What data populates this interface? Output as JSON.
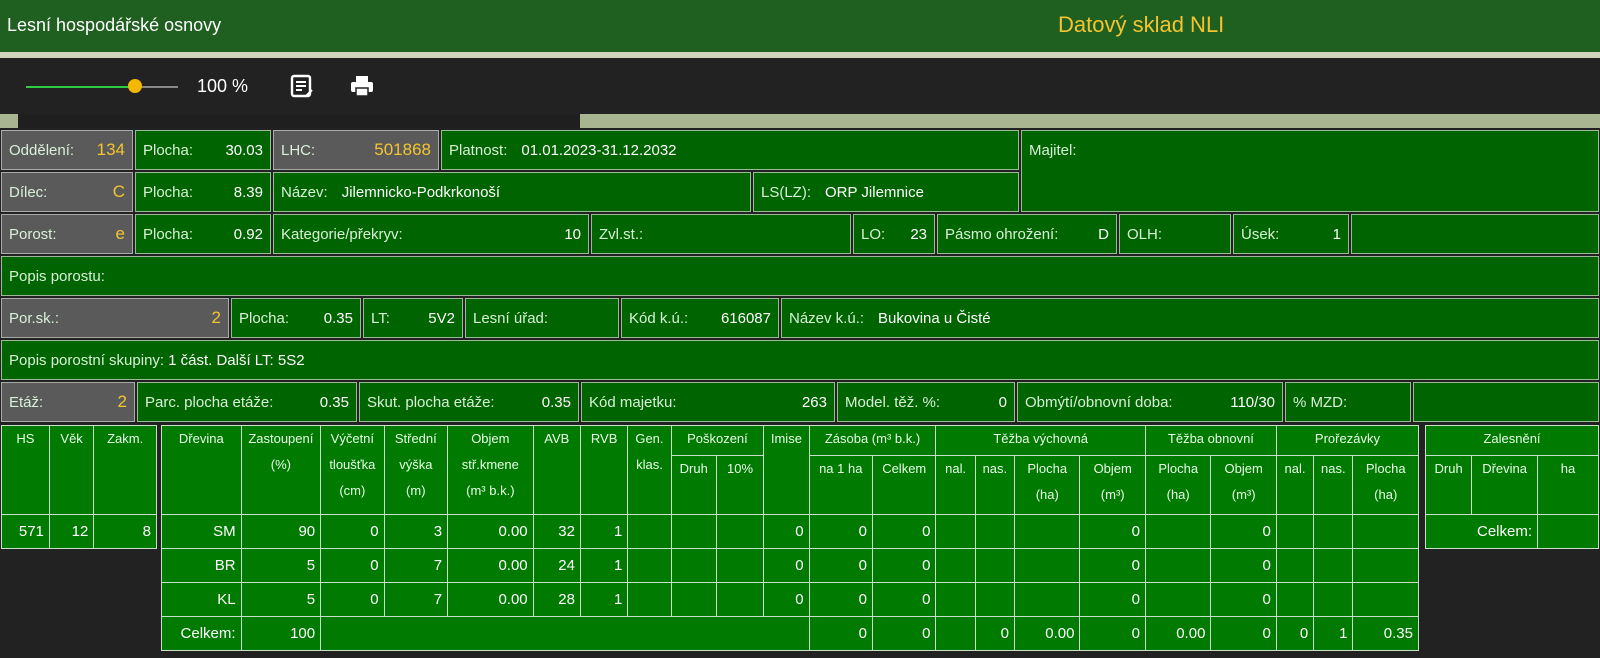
{
  "header": {
    "title": "Lesní hospodářské osnovy",
    "brand": "Datový sklad NLI"
  },
  "toolbar": {
    "zoom_label": "100 %",
    "zoom_value": 0.72,
    "colors": {
      "accent": "#f5b800",
      "header": "#1f5f1f",
      "cell": "#006400"
    }
  },
  "row1": {
    "oddeleni_label": "Oddělení:",
    "oddeleni_value": "134",
    "plocha_label": "Plocha:",
    "plocha_value": "30.03",
    "lhc_label": "LHC:",
    "lhc_value": "501868",
    "platnost_label": "Platnost:",
    "platnost_value": "01.01.2023-31.12.2032",
    "majitel_label": "Majitel:"
  },
  "row2": {
    "dilec_label": "Dílec:",
    "dilec_value": "C",
    "plocha_label": "Plocha:",
    "plocha_value": "8.39",
    "nazev_label": "Název:",
    "nazev_value": "Jilemnicko-Podkrkonoší",
    "ls_label": "LS(LZ):",
    "ls_value": "ORP Jilemnice"
  },
  "row3": {
    "porost_label": "Porost:",
    "porost_value": "e",
    "plocha_label": "Plocha:",
    "plocha_value": "0.92",
    "kategorie_label": "Kategorie/překryv:",
    "kategorie_value": "10",
    "zvl_label": "Zvl.st.:",
    "lo_label": "LO:",
    "lo_value": "23",
    "pasmo_label": "Pásmo ohrožení:",
    "pasmo_value": "D",
    "olh_label": "OLH:",
    "usek_label": "Úsek:",
    "usek_value": "1"
  },
  "row4": {
    "popis_porostu_label": "Popis porostu:"
  },
  "row5": {
    "porsk_label": "Por.sk.:",
    "porsk_value": "2",
    "plocha_label": "Plocha:",
    "plocha_value": "0.35",
    "lt_label": "LT:",
    "lt_value": "5V2",
    "lesni_urad_label": "Lesní úřad:",
    "kod_ku_label": "Kód k.ú.:",
    "kod_ku_value": "616087",
    "nazev_ku_label": "Název k.ú.:",
    "nazev_ku_value": "Bukovina u Čisté"
  },
  "row6": {
    "popis_skupiny_label": "Popis porostní skupiny:",
    "popis_skupiny_value": "1 část. Další LT: 5S2"
  },
  "row7": {
    "etaz_label": "Etáž:",
    "etaz_value": "2",
    "parc_label": "Parc. plocha etáže:",
    "parc_value": "0.35",
    "skut_label": "Skut. plocha etáže:",
    "skut_value": "0.35",
    "kod_majetku_label": "Kód majetku:",
    "kod_majetku_value": "263",
    "model_label": "Model. těž. %:",
    "model_value": "0",
    "obmyti_label": "Obmýtí/obnovní doba:",
    "obmyti_value": "110/30",
    "mzd_label": "% MZD:"
  },
  "hs_table": {
    "headers": [
      "HS",
      "Věk",
      "Zakm."
    ],
    "values": [
      "571",
      "12",
      "8"
    ]
  },
  "main_table": {
    "h_drevina": "Dřevina",
    "h_zastoupeni": [
      "Zastoupení",
      "(%)"
    ],
    "h_vycetni": [
      "Výčetní",
      "tloušťka",
      "(cm)"
    ],
    "h_stredni": [
      "Střední",
      "výška",
      "(m)"
    ],
    "h_objem": [
      "Objem",
      "stř.kmene",
      "(m³ b.k.)"
    ],
    "h_avb": "AVB",
    "h_rvb": "RVB",
    "h_gen": [
      "Gen.",
      "klas."
    ],
    "h_poskozeni": "Poškození",
    "h_druh": "Druh",
    "h_10": "10%",
    "h_imise": "Imise",
    "h_zasoba": "Zásoba (m³ b.k.)",
    "h_na1ha": "na 1 ha",
    "h_celkem": "Celkem",
    "h_tv": "Těžba výchovná",
    "h_nal": "nal.",
    "h_nas": "nas.",
    "h_plocha": [
      "Plocha",
      "(ha)"
    ],
    "h_objem3": [
      "Objem",
      "(m³)"
    ],
    "h_to": "Těžba obnovní",
    "h_prorezavky": "Prořezávky",
    "rows": [
      {
        "drevina": "SM",
        "zastoupeni": "90",
        "vycetni": "0",
        "stredni": "3",
        "objem": "0.00",
        "avb": "32",
        "rvb": "1",
        "imise": "0",
        "na1ha": "0",
        "celkem": "0",
        "tv_objem": "0",
        "to_objem": "0"
      },
      {
        "drevina": "BR",
        "zastoupeni": "5",
        "vycetni": "0",
        "stredni": "7",
        "objem": "0.00",
        "avb": "24",
        "rvb": "1",
        "imise": "0",
        "na1ha": "0",
        "celkem": "0",
        "tv_objem": "0",
        "to_objem": "0"
      },
      {
        "drevina": "KL",
        "zastoupeni": "5",
        "vycetni": "0",
        "stredni": "7",
        "objem": "0.00",
        "avb": "28",
        "rvb": "1",
        "imise": "0",
        "na1ha": "0",
        "celkem": "0",
        "tv_objem": "0",
        "to_objem": "0"
      }
    ],
    "total": {
      "label": "Celkem:",
      "zastoupeni": "100",
      "na1ha": "0",
      "celkem": "0",
      "tv_nas": "0",
      "tv_plocha": "0.00",
      "tv_objem": "0",
      "to_plocha": "0.00",
      "to_objem": "0",
      "pr_nal": "0",
      "pr_nas": "1",
      "pr_plocha": "0.35"
    }
  },
  "zalesneni": {
    "title": "Zalesnění",
    "h_druh": "Druh",
    "h_drevina": "Dřevina",
    "h_ha": "ha",
    "total_label": "Celkem:"
  }
}
